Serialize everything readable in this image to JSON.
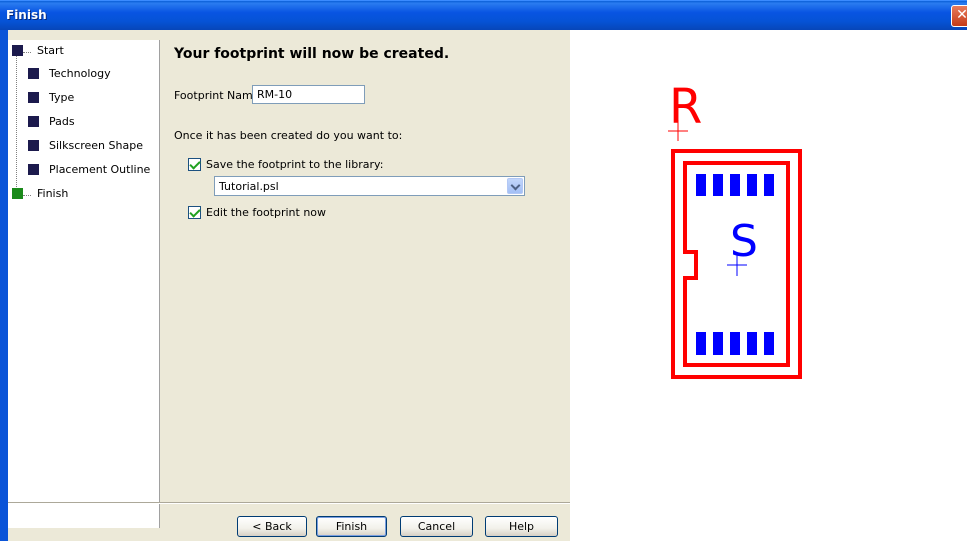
{
  "window": {
    "title": "Finish",
    "close_glyph": "✕"
  },
  "steps": [
    {
      "label": "Start",
      "state": "done"
    },
    {
      "label": "Technology",
      "state": "done"
    },
    {
      "label": "Type",
      "state": "done"
    },
    {
      "label": "Pads",
      "state": "done"
    },
    {
      "label": "Silkscreen Shape",
      "state": "done"
    },
    {
      "label": "Placement Outline",
      "state": "done"
    },
    {
      "label": "Finish",
      "state": "current"
    }
  ],
  "main": {
    "heading": "Your footprint will now be created.",
    "footprint_name_label": "Footprint Name:",
    "footprint_name_value": "RM-10",
    "question": "Once it has been created do you want to:",
    "save_checkbox": {
      "label": "Save the footprint to the library:",
      "checked": true
    },
    "library_select": {
      "value": "Tutorial.psl"
    },
    "edit_checkbox": {
      "label": "Edit the footprint now",
      "checked": true
    }
  },
  "buttons": {
    "back": "< Back",
    "finish": "Finish",
    "cancel": "Cancel",
    "help": "Help"
  },
  "preview": {
    "ref_designator": "R",
    "origin_label": "S",
    "colors": {
      "silkscreen": "#ff0000",
      "pads": "#0000ff"
    }
  }
}
